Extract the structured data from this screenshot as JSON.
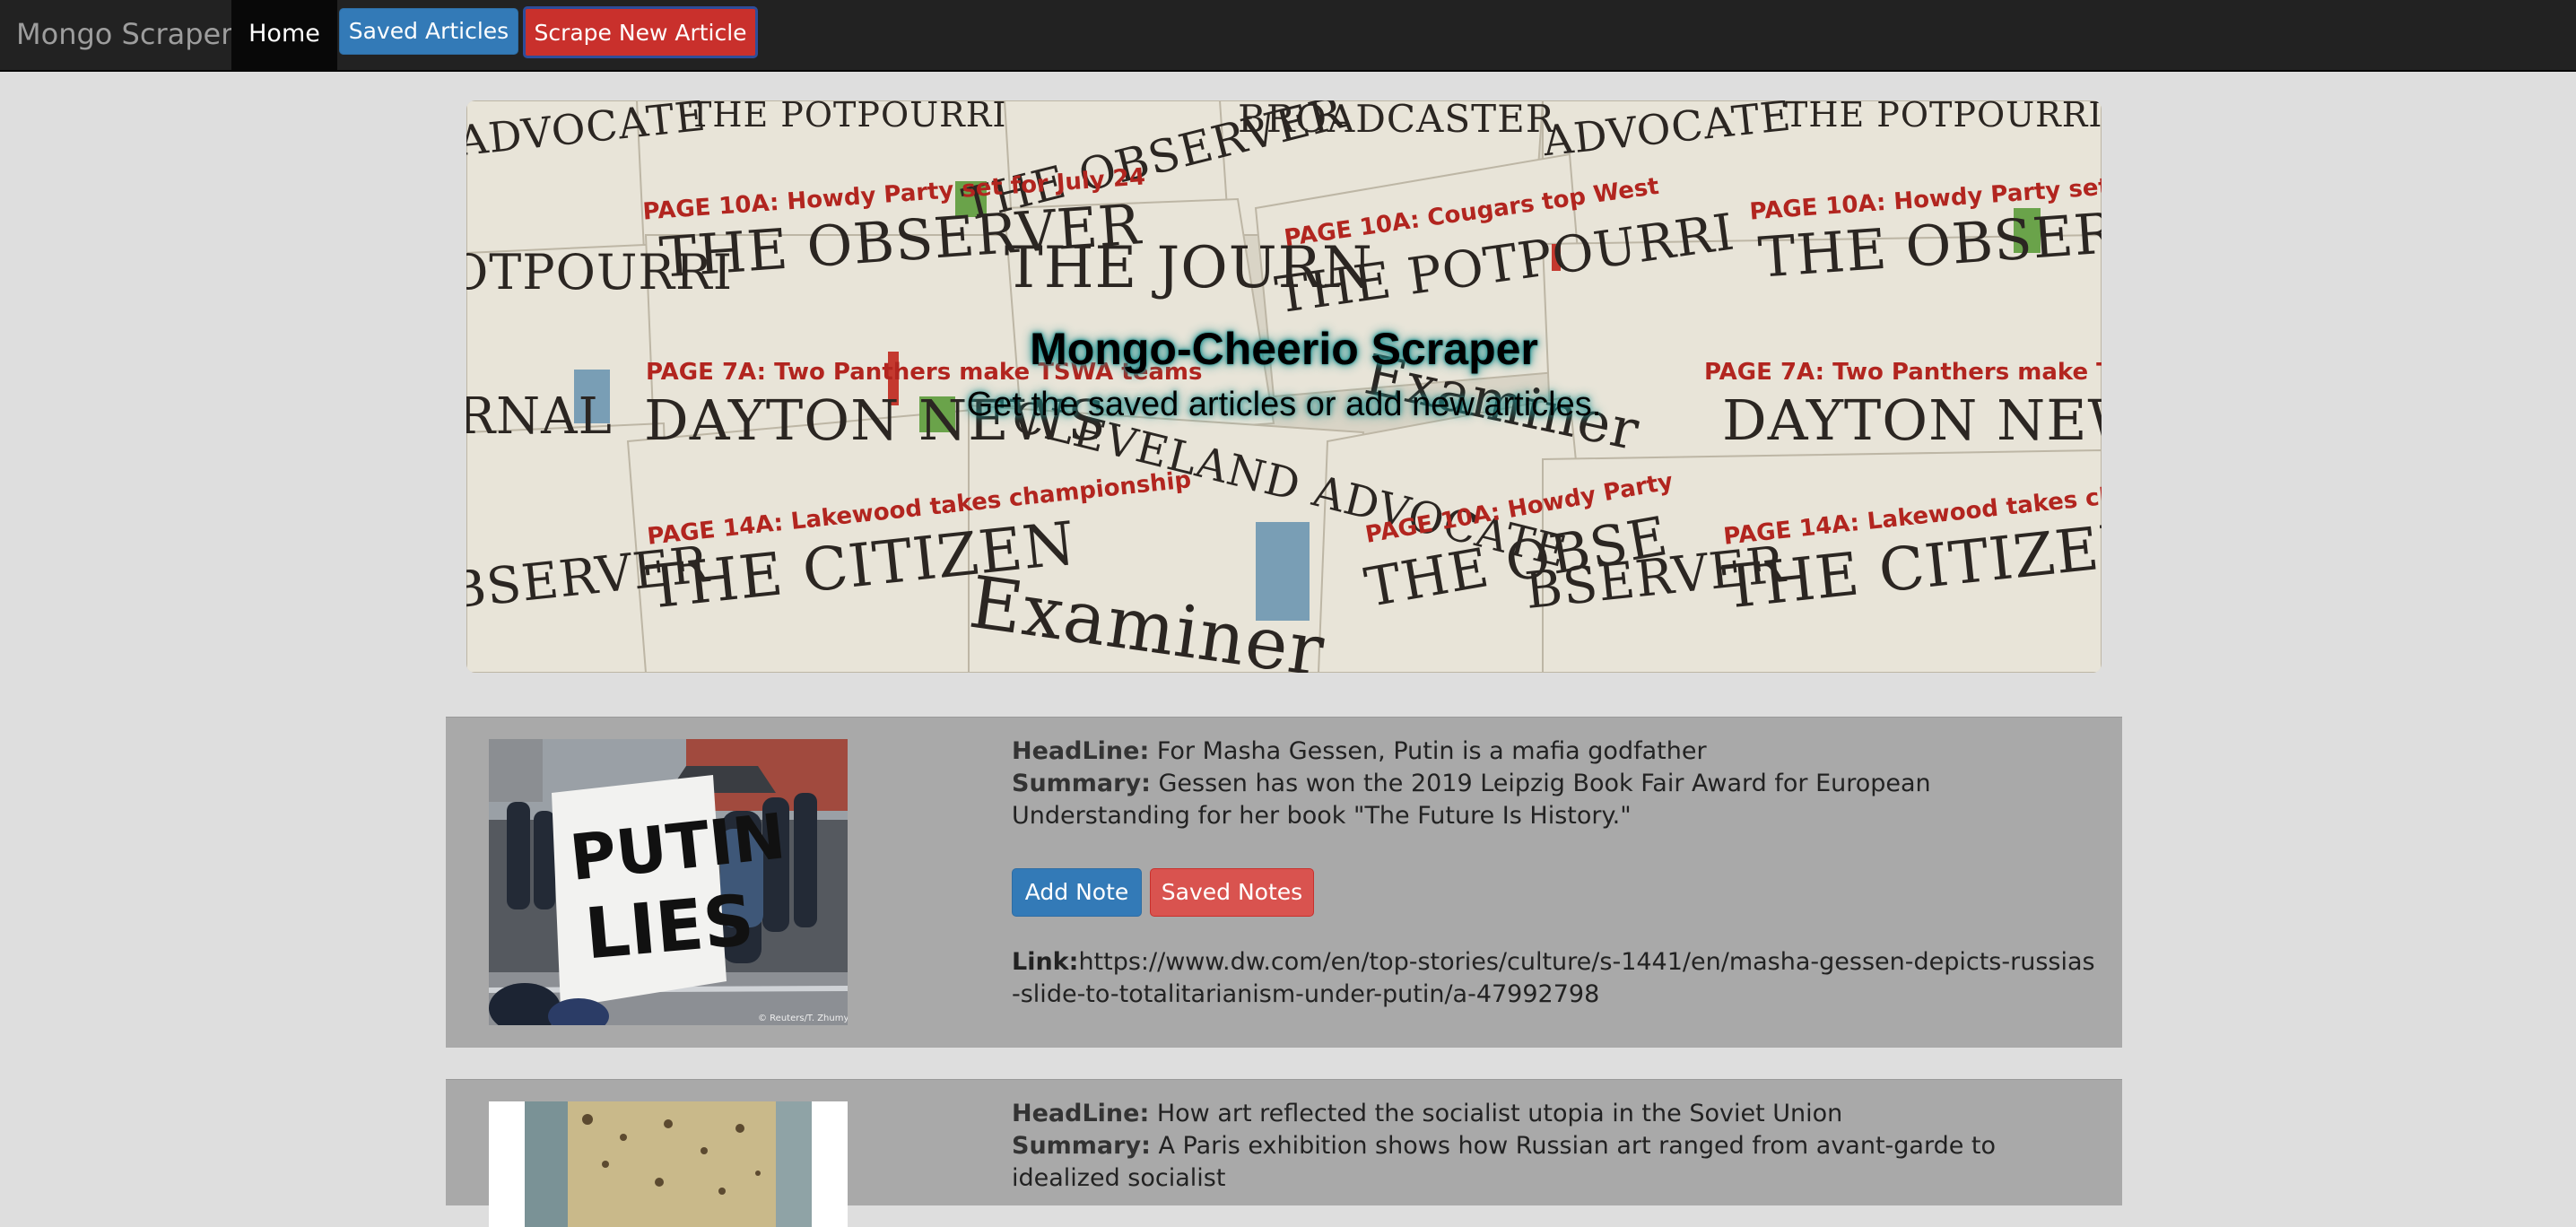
{
  "navbar": {
    "brand": "Mongo Scraper",
    "home_label": "Home",
    "saved_articles_label": "Saved Articles",
    "scrape_label": "Scrape New Article"
  },
  "jumbotron": {
    "title": "Mongo-Cheerio Scraper",
    "subtitle": "Get the saved articles or add new articles."
  },
  "articles": [
    {
      "headline_label": "HeadLine:",
      "headline": "For Masha Gessen, Putin is a mafia godfather",
      "summary_label": "Summary:",
      "summary": "Gessen has won the 2019 Leipzig Book Fair Award for European Understanding for her book \"The Future Is History.\"",
      "add_note_label": "Add Note",
      "saved_notes_label": "Saved Notes",
      "link_label": "Link:",
      "link": "https://www.dw.com/en/top-stories/culture/s-1441/en/masha-gessen-depicts-russias-slide-to-totalitarianism-under-putin/a-47992798",
      "image_caption": "© Reuters/T. Zhumykay",
      "sign_text": [
        "PUTIN",
        "LIES"
      ]
    },
    {
      "headline_label": "HeadLine:",
      "headline": "How art reflected the socialist utopia in the Soviet Union",
      "summary_label": "Summary:",
      "summary": "A Paris exhibition shows how Russian art ranged from avant-garde to idealized socialist"
    }
  ],
  "colors": {
    "navbar_bg": "#222222",
    "primary": "#337ab7",
    "danger": "#d9534f",
    "card_bg": "#a9a9a9"
  }
}
